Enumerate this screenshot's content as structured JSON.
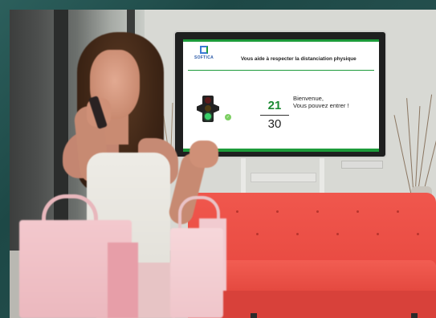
{
  "screen": {
    "brand": "SOFTICA",
    "headline": "Vous aide à respecter la distanciation physique",
    "counter": {
      "current": "21",
      "max": "30"
    },
    "welcome_line1": "Bienvenue,",
    "welcome_line2": "Vous pouvez entrer !",
    "status_light": "green",
    "status_badge_icon": "check-icon",
    "colors": {
      "accent_green": "#1c9b3a",
      "counter_green": "#1c8a33",
      "sofa_red": "#ec4f46",
      "background_teal": "#1f4d4b"
    }
  }
}
